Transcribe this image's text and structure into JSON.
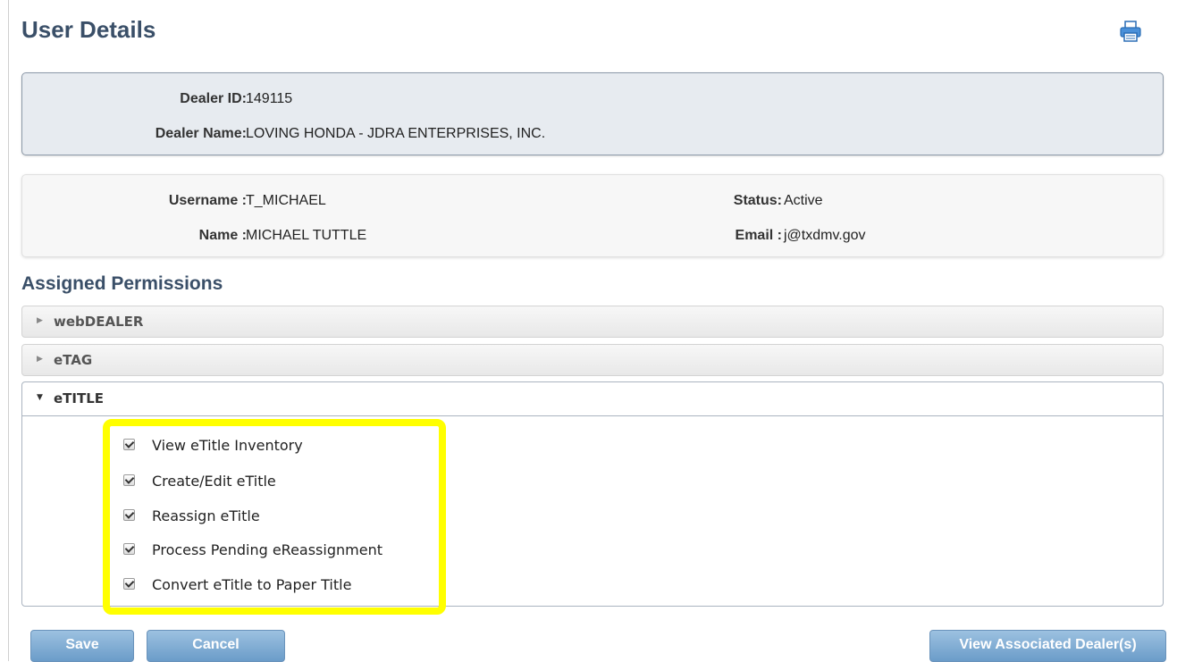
{
  "page": {
    "title": "User Details"
  },
  "toolbar": {
    "print_icon": "printer-icon"
  },
  "dealer": {
    "id_label": "Dealer ID:",
    "id_value": "149115",
    "name_label": "Dealer Name:",
    "name_value": "LOVING HONDA - JDRA ENTERPRISES, INC."
  },
  "user": {
    "username_label": "Username :",
    "username_value": "T_MICHAEL",
    "name_label": "Name :",
    "name_value": "MICHAEL TUTTLE",
    "status_label": "Status:",
    "status_value": "Active",
    "email_label": "Email :",
    "email_value": "j@txdmv.gov"
  },
  "permissions": {
    "title": "Assigned Permissions",
    "sections": [
      {
        "label": "webDEALER",
        "expanded": false
      },
      {
        "label": "eTAG",
        "expanded": false
      },
      {
        "label": "eTITLE",
        "expanded": true
      }
    ],
    "etitle_items": [
      {
        "label": "View eTitle Inventory",
        "checked": true
      },
      {
        "label": "Create/Edit eTitle",
        "checked": true
      },
      {
        "label": "Reassign eTitle",
        "checked": true
      },
      {
        "label": "Process Pending eReassignment",
        "checked": true
      },
      {
        "label": "Convert eTitle to Paper Title",
        "checked": true
      }
    ]
  },
  "buttons": {
    "save": "Save",
    "cancel": "Cancel",
    "view_dealers": "View Associated Dealer(s)"
  },
  "colors": {
    "heading": "#3a4f68",
    "highlight": "#ffff00",
    "button": "#7aa7d1"
  }
}
